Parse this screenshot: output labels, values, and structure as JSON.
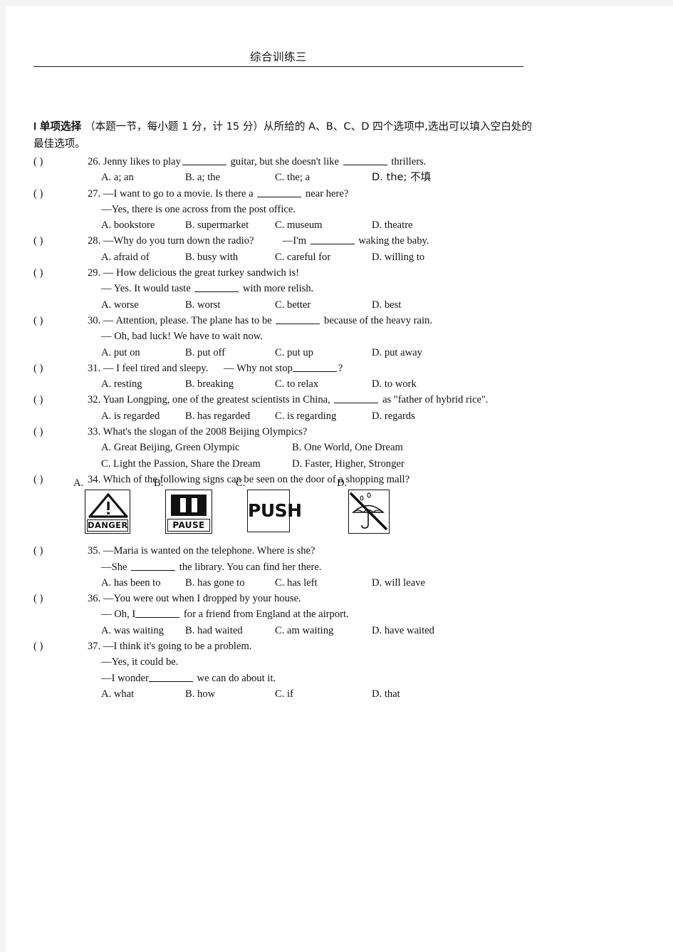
{
  "header": {
    "title": "综合训练三"
  },
  "section": {
    "roman": "Ⅰ",
    "name": "单项选择",
    "instructions_part1": "（本题一节，每小题 1 分，计 15 分）从所给的 A、B、C、D 四个选项中",
    "instructions_part2": ",选出可以填入空白处的最佳选项。"
  },
  "questions": [
    {
      "paren": "(        )",
      "number": "26.",
      "stem": "Jenny likes to play",
      "stem_after": "guitar, but she doesn't like",
      "stem_tail": "thrillers.",
      "options": [
        "A. a; an",
        "B.  a; the",
        "C. the; a",
        "D. the; 不填"
      ]
    },
    {
      "paren": "(        )",
      "number": "27.",
      "stem": "—I want to go to a movie. Is there a",
      "stem_tail": "near here?",
      "line2": "—Yes, there is one across from the post office.",
      "options": [
        "A. bookstore",
        "B. supermarket",
        "C. museum",
        "D. theatre"
      ]
    },
    {
      "paren": "(        )",
      "number": "28.",
      "stem": "—Why do you turn down the radio?",
      "stem_mid": "—I'm",
      "stem_tail": "waking the baby.",
      "options": [
        "A. afraid of",
        "B. busy with",
        "C. careful for",
        "D. willing to"
      ]
    },
    {
      "paren": "(        )",
      "number": "29.",
      "stem": "— How delicious the great turkey sandwich is!",
      "line2_pre": "— Yes. It would taste",
      "line2_post": "with more relish.",
      "options": [
        "A. worse",
        "B. worst",
        "C. better",
        "D. best"
      ]
    },
    {
      "paren": "(        )",
      "number": "30.",
      "stem": "— Attention, please. The plane has to be",
      "stem_tail": "because of the heavy rain.",
      "line2": "— Oh, bad luck! We have to wait now.",
      "options": [
        "A. put on",
        "B. put off",
        "C. put up",
        "D. put away"
      ]
    },
    {
      "paren": "(        )",
      "number": "31.",
      "stem": "— I feel tired and sleepy.",
      "stem_mid": "— Why not stop",
      "stem_tail": "?",
      "options": [
        "A. resting",
        "B. breaking",
        "C. to relax",
        "D. to work"
      ]
    },
    {
      "paren": "(        )",
      "number": "32.",
      "stem": "Yuan Longping, one of the greatest scientists in China,",
      "stem_tail": "as \"father of hybrid rice\".",
      "options": [
        "A. is regarded",
        "B. has regarded",
        "C. is regarding",
        "D. regards"
      ]
    },
    {
      "paren": "(        )",
      "number": "33.",
      "stem": "What's the slogan of the 2008 Beijing Olympics?",
      "options": [
        "A. Great Beijing, Green Olympic",
        "B. One World, One Dream",
        "C. Light the Passion, Share the Dream",
        "D. Faster, Higher, Stronger"
      ]
    },
    {
      "paren": "(        )",
      "number": "34.",
      "stem": "Which of the following signs can be seen on the door of a shopping mall?",
      "sign_options": [
        {
          "label": "A.",
          "icon": "danger-warning-triangle-sign",
          "text": "DANGER"
        },
        {
          "label": "B.",
          "icon": "pause-bars-sign",
          "text": "PAUSE"
        },
        {
          "label": "C.",
          "icon": "push-text-sign",
          "text": "PUSH"
        },
        {
          "label": "D.",
          "icon": "no-umbrella-crossed-out-sign",
          "text": ""
        }
      ]
    },
    {
      "paren": "(        )",
      "number": "35.",
      "stem": "—Maria is wanted on the telephone. Where is she?",
      "line2_pre": "—She",
      "line2_post": "the library. You can find her there.",
      "options": [
        "A. has been to",
        "B. has gone to",
        "C. has left",
        "D. will leave"
      ]
    },
    {
      "paren": "(        )",
      "number": "36.",
      "stem": "—You were out when I dropped by your house.",
      "line2_pre": "— Oh, I",
      "line2_post": "for a friend from England at the airport.",
      "options": [
        "A. was waiting",
        "B. had waited",
        "C. am waiting",
        "D. have waited"
      ]
    },
    {
      "paren": "(        )",
      "number": "37.",
      "stem": "—I think it's going to be a problem.",
      "line2": "—Yes, it could be.",
      "line3_pre": "—I wonder",
      "line3_post": "we can do about it.",
      "options": [
        "A. what",
        "B. how",
        "C. if",
        "D. that"
      ]
    }
  ]
}
